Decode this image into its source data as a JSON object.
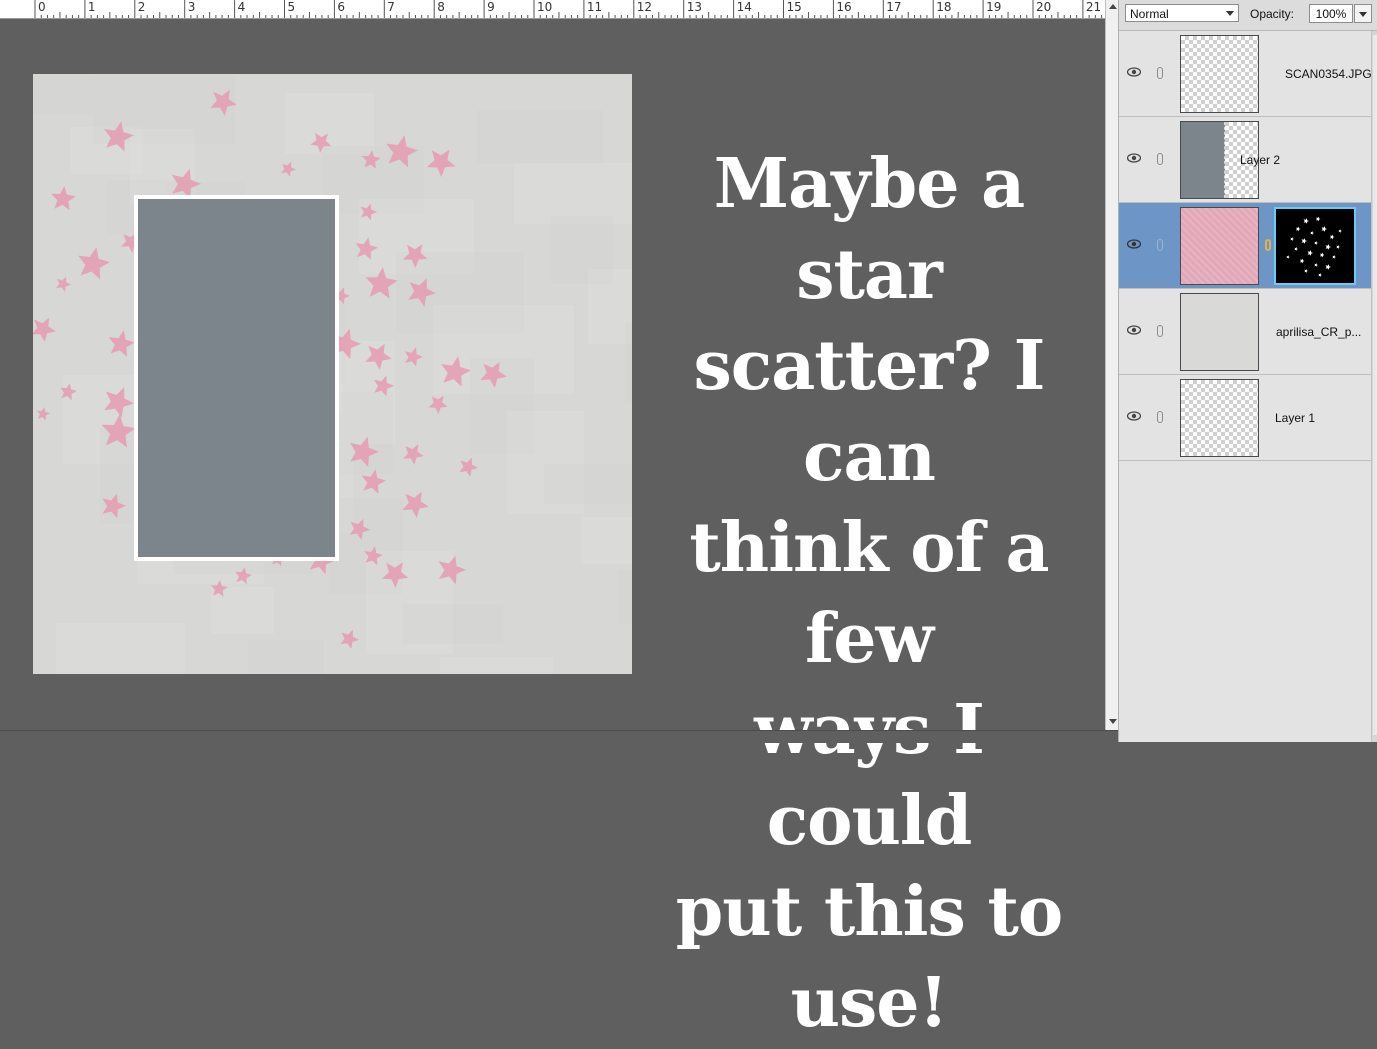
{
  "ruler": {
    "numbers": [
      "0",
      "1",
      "2",
      "3",
      "4",
      "5",
      "6",
      "7",
      "8",
      "9",
      "10",
      "11",
      "12",
      "13",
      "14",
      "15",
      "16",
      "17",
      "18",
      "19",
      "20",
      "21"
    ]
  },
  "canvas": {
    "overlay_text_lines": [
      "Maybe a star",
      "scatter? I can",
      "think of a few",
      "ways I could",
      "put this to use!"
    ],
    "star_color": "#e59bb0",
    "paper_color": "#d7d7d6",
    "photo_slot_color": "#7d858c"
  },
  "layers_panel": {
    "blend_mode": "Normal",
    "opacity_label": "Opacity:",
    "opacity_value": "100%",
    "layers": [
      {
        "name": "SCAN0354.JPG",
        "thumb": "transparent",
        "selected": false
      },
      {
        "name": "Layer 2",
        "thumb": "gray",
        "selected": false
      },
      {
        "name": "",
        "thumb": "pink-with-star-mask",
        "selected": true
      },
      {
        "name": "aprilisa_CR_p...",
        "thumb": "paper",
        "selected": false
      },
      {
        "name": "Layer 1",
        "thumb": "transparent",
        "selected": false
      }
    ],
    "selection_color": "#6d95c6"
  }
}
